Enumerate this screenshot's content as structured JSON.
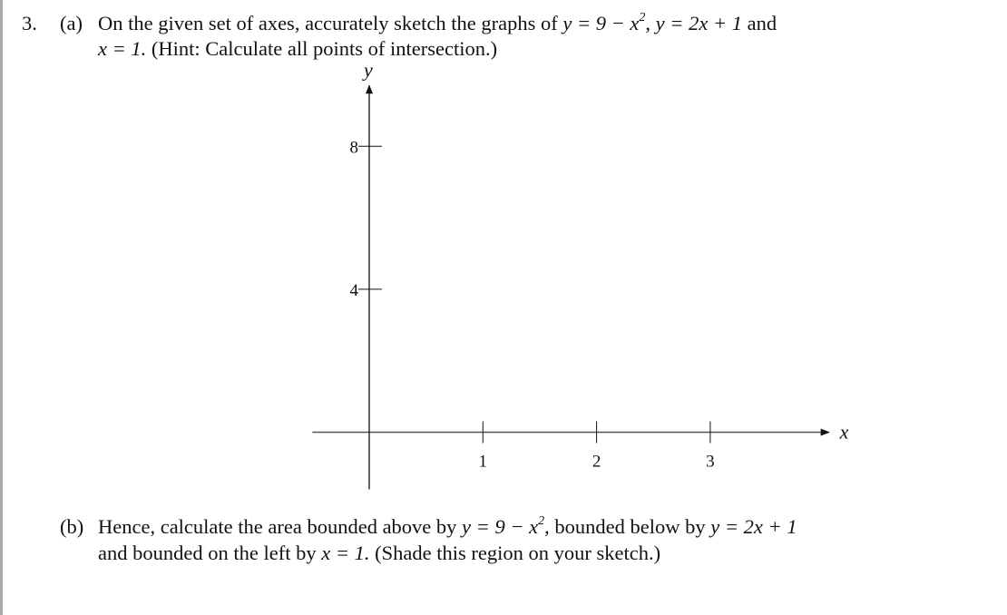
{
  "question": {
    "number": "3.",
    "part_a": {
      "label": "(a)",
      "line1_text": "On the given set of axes, accurately sketch the graphs of",
      "eq1": "y = 9 − x",
      "eq1_exp": "2",
      "sep": ",",
      "eq2": "y = 2x + 1",
      "and": "and",
      "line2_eq": "x = 1.",
      "line2_text": "(Hint: Calculate all points of intersection.)"
    },
    "part_b": {
      "label": "(b)",
      "line1_text": "Hence, calculate the area bounded above by",
      "eq1": "y = 9 − x",
      "eq1_exp": "2",
      "mid": ", bounded below by",
      "eq2": "y = 2x + 1",
      "line2_text_a": "and bounded on the left by",
      "line2_eq": "x = 1.",
      "line2_text_b": "(Shade this region on your sketch.)"
    }
  },
  "axes": {
    "x_label": "x",
    "y_label": "y",
    "x_ticks": [
      {
        "value": 1,
        "label": "1"
      },
      {
        "value": 2,
        "label": "2"
      },
      {
        "value": 3,
        "label": "3"
      }
    ],
    "y_ticks": [
      {
        "value": 4,
        "label": "4"
      },
      {
        "value": 8,
        "label": "8"
      }
    ],
    "x_range": [
      -0.5,
      3.9
    ],
    "y_range": [
      -1.6,
      9.6
    ],
    "line_color": "#111111",
    "x_axis_color": "#555555"
  }
}
